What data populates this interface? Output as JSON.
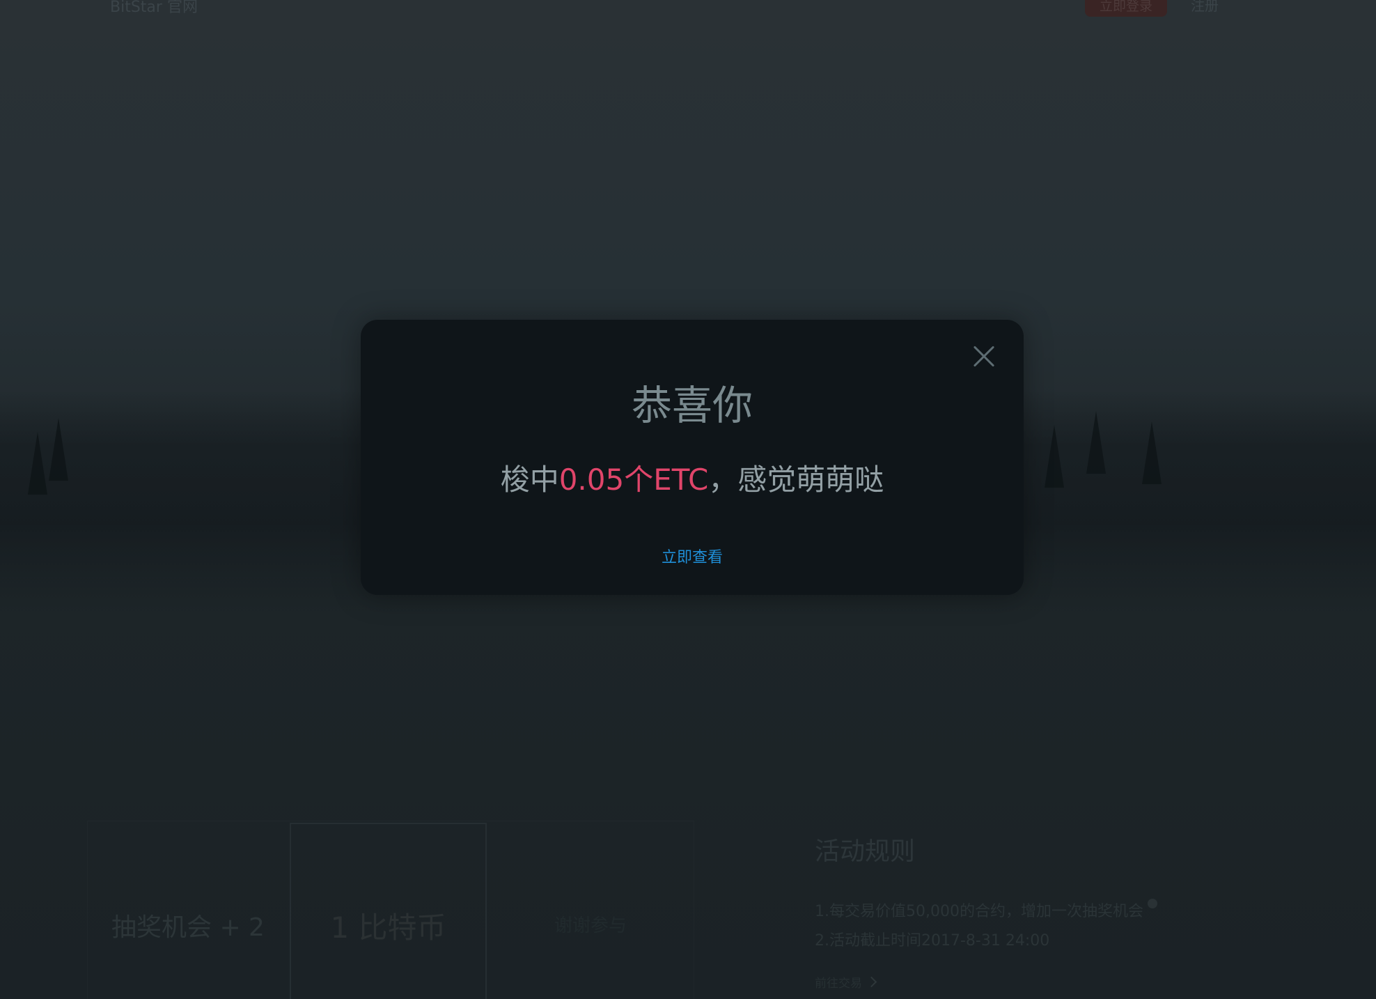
{
  "header": {
    "brand": "BitStar 官网",
    "login_button": "立即登录",
    "register_link": "注册"
  },
  "modal": {
    "title": "恭喜你",
    "message_prefix": "梭中",
    "message_highlight": "0.05个ETC",
    "message_suffix": "，感觉萌萌哒",
    "link": "立即查看",
    "highlight_color": "#e0456a",
    "link_color": "#1f8fd8",
    "close_icon": "close-icon"
  },
  "bottom": {
    "chance_text": "抽奖机会 + 2",
    "prize_text": "1 比特币",
    "ghost_text": "谢谢参与",
    "rules_title": "活动规则",
    "rule_1": "1.每交易价值50,000的合约，增加一次抽奖机会",
    "rule_2": "2.活动截止时间2017-8-31 24:00",
    "go_trade": "前往交易"
  }
}
